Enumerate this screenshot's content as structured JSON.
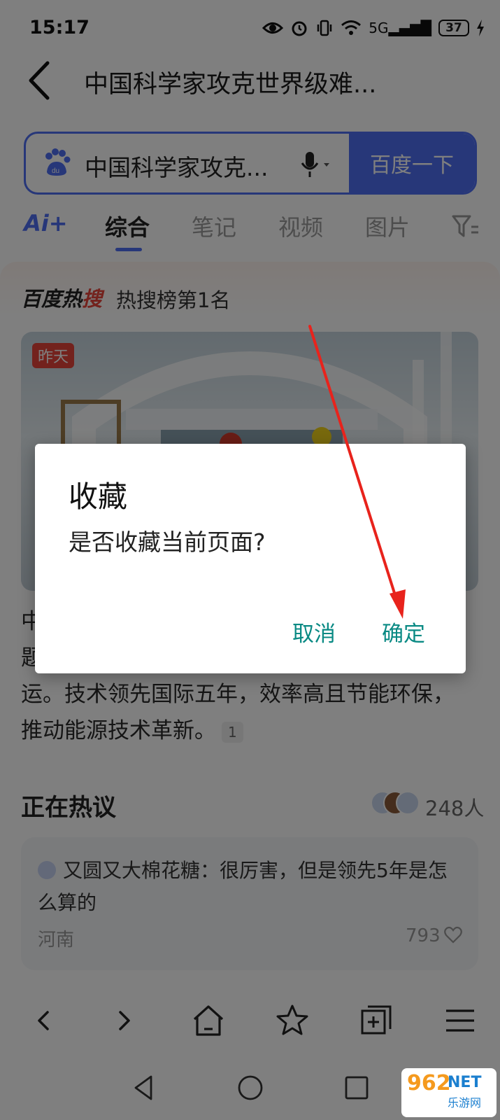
{
  "status_bar": {
    "time": "15:17",
    "battery": "37",
    "network": "5G"
  },
  "header": {
    "title": "中国科学家攻克世界级难..."
  },
  "search": {
    "query": "中国科学家攻克...",
    "button_label": "百度一下"
  },
  "tabs": [
    {
      "label": "Ai+"
    },
    {
      "label": "综合"
    },
    {
      "label": "笔记"
    },
    {
      "label": "视频"
    },
    {
      "label": "图片"
    }
  ],
  "hot_search": {
    "brand_black": "百度热",
    "brand_red": "搜",
    "rank": "热搜榜第1名"
  },
  "news": {
    "badge": "昨天",
    "text_line1": "中",
    "text_line2": "题",
    "text_line3": "运。技术领先国际五年，效率高且节能环保，",
    "text_line4": "推动能源技术革新。",
    "cite": "1"
  },
  "discussion": {
    "heading": "正在热议",
    "participants": "248人",
    "comment": {
      "author_text": "又圆又大棉花糖：很厉害，但是领先5年是怎",
      "text_line2": "么算的",
      "location": "河南",
      "likes": "793"
    }
  },
  "dialog": {
    "title": "收藏",
    "message": "是否收藏当前页面?",
    "cancel": "取消",
    "confirm": "确定"
  },
  "watermark": {
    "logo": "962",
    "net": "NET",
    "sub": "乐游网"
  },
  "colors": {
    "accent": "#4e6ef2",
    "dialog_button": "#0a8a84",
    "hot_red": "#e6443a",
    "annotation_arrow": "#e8231c"
  }
}
